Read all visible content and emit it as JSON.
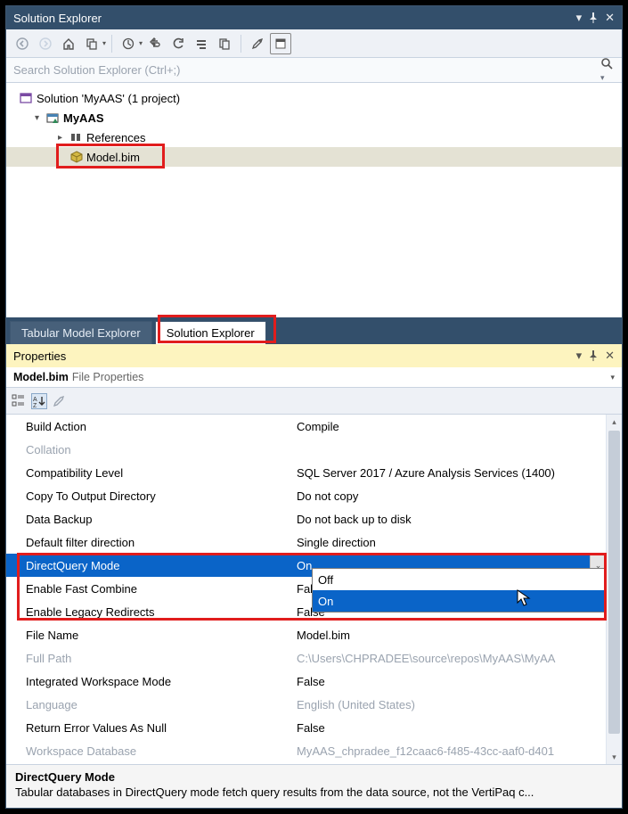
{
  "solution_explorer": {
    "title": "Solution Explorer",
    "search_placeholder": "Search Solution Explorer (Ctrl+;)",
    "tree": {
      "solution_label": "Solution 'MyAAS' (1 project)",
      "project_label": "MyAAS",
      "references_label": "References",
      "model_label": "Model.bim"
    },
    "tabs": {
      "tabular": "Tabular Model Explorer",
      "solution": "Solution Explorer"
    }
  },
  "properties": {
    "title": "Properties",
    "subject": "Model.bim",
    "subject_kind": "File Properties",
    "rows": [
      {
        "k": "Build Action",
        "v": "Compile"
      },
      {
        "k": "Collation",
        "v": "",
        "muted": true
      },
      {
        "k": "Compatibility Level",
        "v": "SQL Server 2017 / Azure Analysis Services (1400)"
      },
      {
        "k": "Copy To Output Directory",
        "v": "Do not copy"
      },
      {
        "k": "Data Backup",
        "v": "Do not back up to disk"
      },
      {
        "k": "Default filter direction",
        "v": "Single direction"
      },
      {
        "k": "DirectQuery Mode",
        "v": "On",
        "selected": true
      },
      {
        "k": "Enable Fast Combine",
        "v": "False"
      },
      {
        "k": "Enable Legacy Redirects",
        "v": "False"
      },
      {
        "k": "File Name",
        "v": "Model.bim"
      },
      {
        "k": "Full Path",
        "v": "C:\\Users\\CHPRADEE\\source\\repos\\MyAAS\\MyAA",
        "muted": true
      },
      {
        "k": "Integrated Workspace Mode",
        "v": "False"
      },
      {
        "k": "Language",
        "v": "English (United States)",
        "muted": true
      },
      {
        "k": "Return Error Values As Null",
        "v": "False"
      },
      {
        "k": "Workspace Database",
        "v": "MyAAS_chpradee_f12caac6-f485-43cc-aaf0-d401",
        "muted": true
      }
    ],
    "dropdown": {
      "options": [
        "Off",
        "On"
      ],
      "selected": "On"
    },
    "desc": {
      "title": "DirectQuery Mode",
      "text": "Tabular databases in DirectQuery mode fetch query results from the data source, not the VertiPaq c..."
    }
  }
}
